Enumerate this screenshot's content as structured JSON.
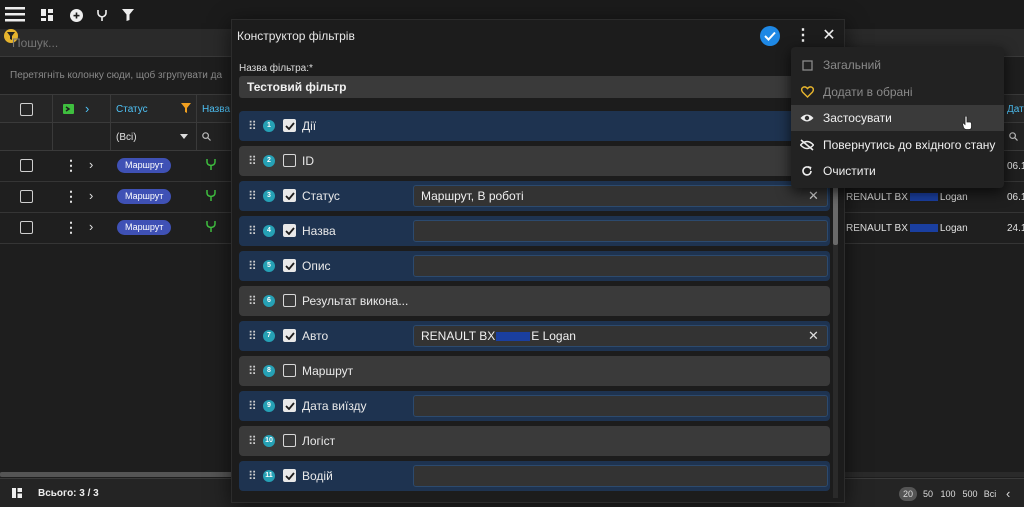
{
  "search": {
    "placeholder": "Пошук..."
  },
  "grid": {
    "group_hint": "Перетягніть колонку сюди, щоб згрупувати да",
    "columns": {
      "status": "Статус",
      "name_partial": "Назва",
      "date_partial": "Дат"
    },
    "status_filter": "(Всі)",
    "rows": [
      {
        "status": "Маршрут",
        "auto": "RENAULT BX",
        "auto_suffix": "Logan",
        "date": "06.1"
      },
      {
        "status": "Маршрут",
        "auto": "RENAULT BX",
        "auto_suffix": "Logan",
        "date": "06.1"
      },
      {
        "status": "Маршрут",
        "auto": "RENAULT BX",
        "auto_suffix": "Logan",
        "date": "24.1"
      }
    ]
  },
  "footer": {
    "total": "Всього: 3 / 3",
    "page_sizes": [
      "20",
      "50",
      "100",
      "500",
      "Всі"
    ],
    "selected_page_size": "20"
  },
  "modal": {
    "title": "Конструктор фільтрів",
    "name_label": "Назва фільтра:*",
    "name_value": "Тестовий фільтр",
    "fields": [
      {
        "num": "1",
        "label": "Дії",
        "checked": true,
        "value": null
      },
      {
        "num": "2",
        "label": "ID",
        "checked": false,
        "value": null
      },
      {
        "num": "3",
        "label": "Статус",
        "checked": true,
        "value": "Маршрут, В роботі",
        "clearable": true
      },
      {
        "num": "4",
        "label": "Назва",
        "checked": true,
        "value": ""
      },
      {
        "num": "5",
        "label": "Опис",
        "checked": true,
        "value": ""
      },
      {
        "num": "6",
        "label": "Результат викона...",
        "checked": false,
        "value": null
      },
      {
        "num": "7",
        "label": "Авто",
        "checked": true,
        "value": "RENAULT BX",
        "value_suffix": "E Logan",
        "clearable": true
      },
      {
        "num": "8",
        "label": "Маршрут",
        "checked": false,
        "value": null
      },
      {
        "num": "9",
        "label": "Дата виїзду",
        "checked": true,
        "value": ""
      },
      {
        "num": "10",
        "label": "Логіст",
        "checked": false,
        "value": null
      },
      {
        "num": "11",
        "label": "Водій",
        "checked": true,
        "value": ""
      }
    ]
  },
  "menu": {
    "items": [
      {
        "label": "Загальний",
        "icon": "checkbox-icon",
        "disabled": true
      },
      {
        "label": "Додати в обрані",
        "icon": "heart-icon",
        "disabled": true
      },
      {
        "label": "Застосувати",
        "icon": "eye-icon",
        "disabled": false,
        "hovered": true
      },
      {
        "label": "Повернутись до вхідного стану",
        "icon": "eye-off-icon",
        "disabled": false
      },
      {
        "label": "Очистити",
        "icon": "refresh-icon",
        "disabled": false
      }
    ]
  },
  "colors": {
    "accent": "#1e88e5",
    "badge": "#3f51b5",
    "heart": "#e6b42d",
    "num_badge": "#26a1b5"
  }
}
